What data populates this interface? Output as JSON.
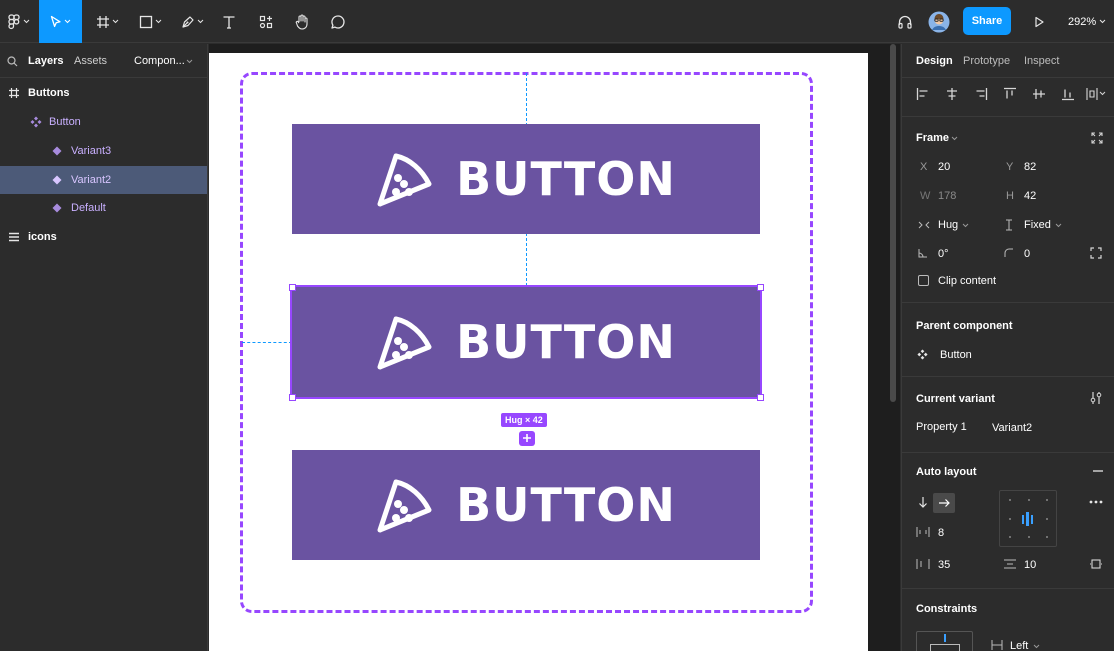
{
  "toolbar": {
    "share_label": "Share",
    "zoom_label": "292%"
  },
  "layers_panel": {
    "tabs": {
      "layers": "Layers",
      "assets": "Assets",
      "page": "Compon..."
    },
    "items": [
      {
        "label": "Buttons"
      },
      {
        "label": "Button"
      },
      {
        "label": "Variant3"
      },
      {
        "label": "Variant2"
      },
      {
        "label": "Default"
      },
      {
        "label": "icons"
      }
    ]
  },
  "canvas": {
    "button_label": "BUTTON",
    "hug_badge": "Hug × 42",
    "colors": {
      "button_bg": "#6a53a1",
      "selection": "#9747ff",
      "guide": "#0d99ff"
    }
  },
  "design_panel": {
    "tabs": {
      "design": "Design",
      "prototype": "Prototype",
      "inspect": "Inspect"
    },
    "frame": {
      "title": "Frame",
      "x_label": "X",
      "x": "20",
      "y_label": "Y",
      "y": "82",
      "w_label": "W",
      "w": "178",
      "h_label": "H",
      "h": "42",
      "width_mode": "Hug",
      "height_mode": "Fixed",
      "rotation": "0°",
      "radius": "0",
      "clip_content": "Clip content"
    },
    "parent_component": {
      "title": "Parent component",
      "name": "Button"
    },
    "current_variant": {
      "title": "Current variant",
      "property": "Property 1",
      "value": "Variant2"
    },
    "auto_layout": {
      "title": "Auto layout",
      "spacing": "8",
      "h_padding": "35",
      "v_padding": "10"
    },
    "constraints": {
      "title": "Constraints",
      "horizontal": "Left"
    }
  }
}
